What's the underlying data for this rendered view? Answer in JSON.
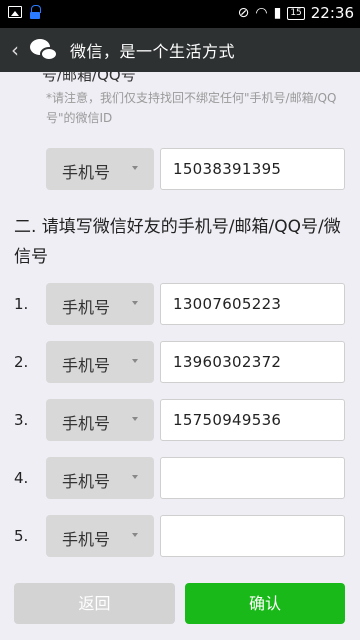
{
  "status_bar": {
    "time": "22:36",
    "battery": "15"
  },
  "title_bar": {
    "title": "微信，是一个生活方式"
  },
  "section1": {
    "cut_label": "号/邮箱/QQ号",
    "note": "*请注意，我们仅支持找回不绑定任何\"手机号/邮箱/QQ号\"的微信ID",
    "field": {
      "type": "手机号",
      "value": "15038391395"
    }
  },
  "section2": {
    "heading": "二. 请填写微信好友的手机号/邮箱/QQ号/微信号",
    "rows": [
      {
        "num": "1.",
        "type": "手机号",
        "value": "13007605223"
      },
      {
        "num": "2.",
        "type": "手机号",
        "value": "13960302372"
      },
      {
        "num": "3.",
        "type": "手机号",
        "value": "15750949536"
      },
      {
        "num": "4.",
        "type": "手机号",
        "value": ""
      },
      {
        "num": "5.",
        "type": "手机号",
        "value": ""
      }
    ]
  },
  "buttons": {
    "back": "返回",
    "confirm": "确认"
  }
}
